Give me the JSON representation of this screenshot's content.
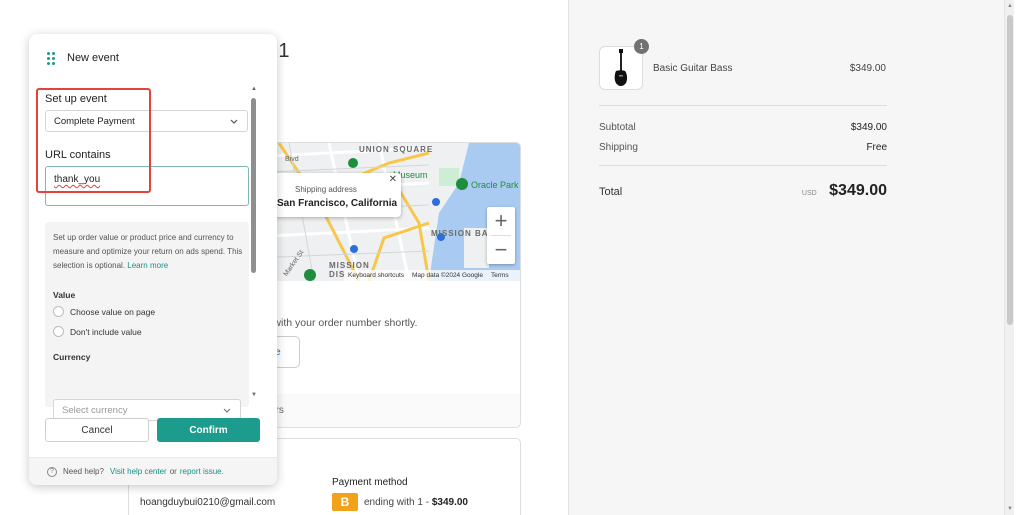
{
  "main": {
    "page_title": "re 1",
    "map": {
      "labels": {
        "union_square": "UNION SQUARE",
        "museum": "Museum",
        "oracle_park": "Oracle Park",
        "mission_bay": "MISSION BAY",
        "mission": "MISSION",
        "dis": "DIS",
        "bivd": "Bivd",
        "market": "Market St"
      },
      "popup_label": "Shipping address",
      "popup_city": "San Francisco, California",
      "zoom_in": "+",
      "zoom_out": "−",
      "footer_shortcuts": "Keyboard shortcuts",
      "footer_data": "Map data ©2024 Google",
      "footer_terms": "Terms"
    },
    "confirmation_text": "ail with your order number shortly.",
    "ghost_button": "age",
    "band_text": "ers",
    "contact_email": "hoangduybui0210@gmail.com",
    "payment": {
      "title": "Payment method",
      "badge": "B",
      "text": "ending with 1 - ",
      "amount": "$349.00"
    }
  },
  "summary": {
    "product": {
      "name": "Basic Guitar Bass",
      "price": "$349.00",
      "qty": "1"
    },
    "subtotal_label": "Subtotal",
    "subtotal_value": "$349.00",
    "shipping_label": "Shipping",
    "shipping_value": "Free",
    "total_label": "Total",
    "total_currency": "USD",
    "total_value": "$349.00"
  },
  "panel": {
    "title": "New event",
    "setup_label": "Set up event",
    "setup_value": "Complete Payment",
    "url_label": "URL contains",
    "url_value": "thank_you",
    "info_text": "Set up order value or product price and currency to measure and optimize your return on ads spend. This selection is optional.",
    "learn_more": "Learn more",
    "value_label": "Value",
    "radio_choose": "Choose value on page",
    "radio_dont": "Don't include value",
    "currency_label": "Currency",
    "currency_placeholder": "Select currency",
    "cancel": "Cancel",
    "confirm": "Confirm",
    "help_prefix": "Need help?",
    "help_link": "Visit help center",
    "help_or": "or",
    "report_link": "report issue."
  },
  "colors": {
    "accent": "#1b9c8d",
    "highlight_box": "#e2433d",
    "badge_orange": "#f1a21a"
  }
}
